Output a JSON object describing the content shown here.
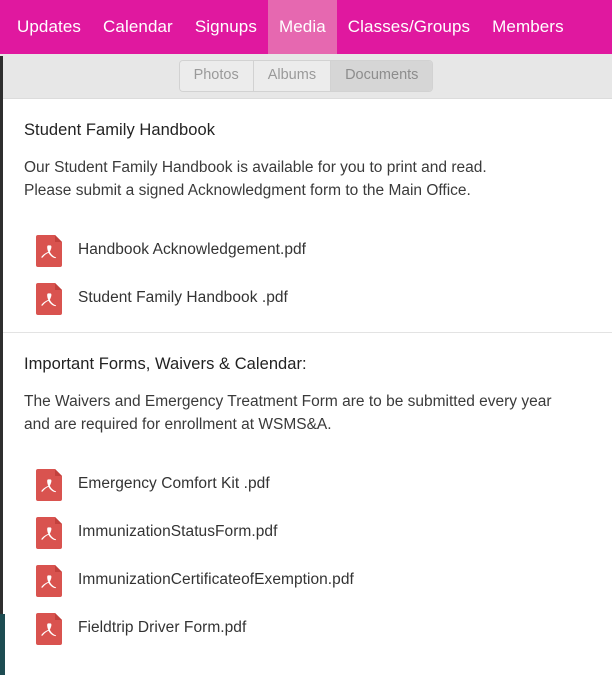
{
  "navbar": {
    "background_color": "#e0189f",
    "active_color": "#e668b0",
    "items": [
      {
        "label": "Updates",
        "active": false
      },
      {
        "label": "Calendar",
        "active": false
      },
      {
        "label": "Signups",
        "active": false
      },
      {
        "label": "Media",
        "active": true
      },
      {
        "label": "Classes/Groups",
        "active": false
      },
      {
        "label": "Members",
        "active": false
      }
    ]
  },
  "subbar": {
    "tabs": [
      {
        "label": "Photos",
        "active": false
      },
      {
        "label": "Albums",
        "active": false
      },
      {
        "label": "Documents",
        "active": true
      }
    ]
  },
  "sections": [
    {
      "title": "Student Family Handbook",
      "body": "Our Student Family Handbook is available for you to print and read.\n Please submit a signed Acknowledgment form to the Main Office.",
      "files": [
        {
          "name": "Handbook Acknowledgement.pdf",
          "icon": "pdf-file-icon"
        },
        {
          "name": "Student Family Handbook .pdf",
          "icon": "pdf-file-icon"
        }
      ]
    },
    {
      "title": "Important Forms, Waivers & Calendar:",
      "body": "The Waivers and Emergency Treatment Form are to be submitted every year and are required for enrollment at WSMS&A.",
      "files": [
        {
          "name": "Emergency Comfort Kit .pdf",
          "icon": "pdf-file-icon"
        },
        {
          "name": "ImmunizationStatusForm.pdf",
          "icon": "pdf-file-icon"
        },
        {
          "name": "ImmunizationCertificateofExemption.pdf",
          "icon": "pdf-file-icon"
        },
        {
          "name": "Fieldtrip Driver Form.pdf",
          "icon": "pdf-file-icon"
        }
      ]
    }
  ],
  "colors": {
    "brand_pink": "#e0189f",
    "brand_pink_light": "#e668b0",
    "pdf_red": "#d9534f",
    "toolbar_gray": "#e7e7e7",
    "text_dark": "#333333"
  }
}
